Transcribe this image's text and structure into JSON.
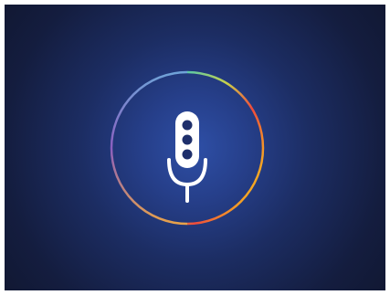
{
  "voice_button": {
    "icon": "microphone-icon",
    "ring_colors": {
      "top_left": "#5ac8a8",
      "top": "#8bd36a",
      "top_right": "#f2b43a",
      "right": "#ef4a3c",
      "bottom_right": "#f08a3a",
      "bottom": "#f5a623",
      "bottom_left": "#e8a24a",
      "left": "#8b5fbf"
    },
    "icon_color": "#ffffff",
    "dot_color": "#1e2f6b"
  },
  "background": {
    "center_color": "#2e4fa6",
    "edge_color": "#111833"
  }
}
